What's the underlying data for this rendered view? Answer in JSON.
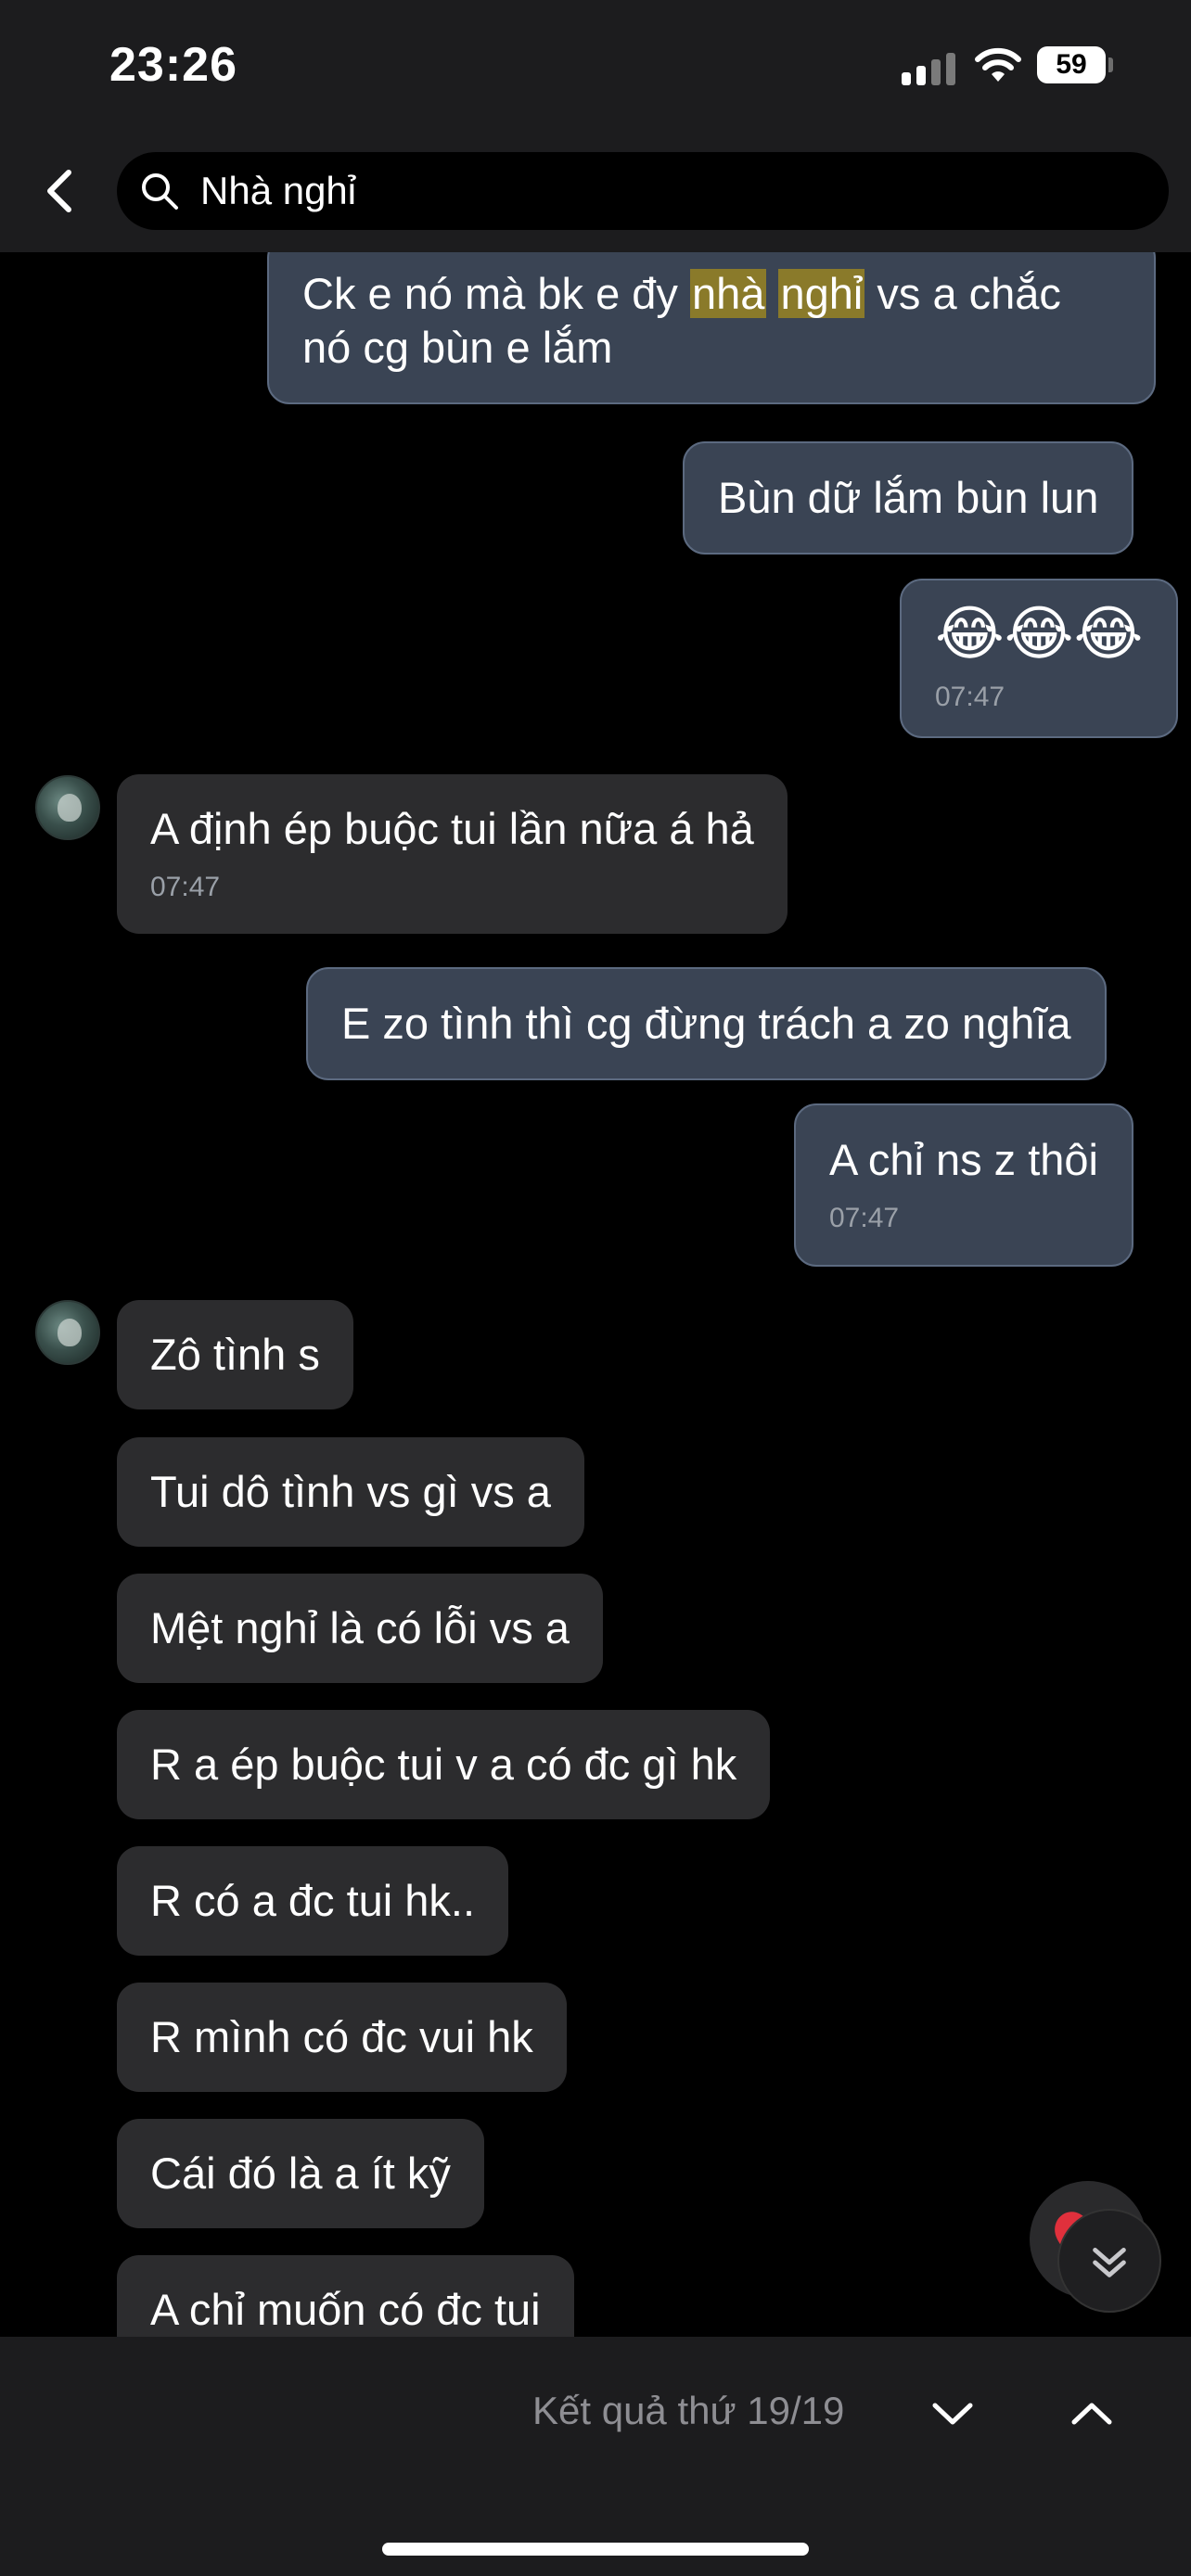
{
  "status": {
    "time": "23:26",
    "battery": "59"
  },
  "search": {
    "query": "Nhà nghỉ"
  },
  "messages": {
    "m1_before": "Ck e nó mà bk e đy ",
    "m1_hl1": "nhà",
    "m1_hl2": "nghỉ",
    "m1_after": " vs a chắc",
    "m1_line2": "nó cg bùn e lắm",
    "m2": "Bùn dữ lắm bùn lun",
    "m3": "😂😂😂",
    "m3_time": "07:47",
    "m4": "A định ép buộc tui lần nữa á hả",
    "m4_time": "07:47",
    "m5": "E zo tình thì cg đừng trách a zo nghĩa",
    "m6": "A chỉ ns z thôi",
    "m6_time": "07:47",
    "m7": "Zô tình s",
    "m8": "Tui dô tình vs gì vs a",
    "m9": "Mệt nghỉ là có lỗi vs a",
    "m10": "R a ép buộc tui v a có đc gì hk",
    "m11": "R có a đc tui hk..",
    "m12": "R mình có đc vui hk",
    "m13": "Cái đó là a ít kỹ",
    "m14": "A chỉ muốn có đc tui"
  },
  "footer": {
    "result": "Kết quả thứ 19/19"
  },
  "colors": {
    "sent_bubble": "#3a4454",
    "received_bubble": "#2c2c2e",
    "highlight": "#8a7a2a",
    "bar": "#1c1c1e"
  },
  "icons": [
    "back-chevron-icon",
    "search-icon",
    "signal-icon",
    "wifi-icon",
    "battery-icon",
    "heart-reaction-icon",
    "double-chevron-down-icon",
    "chevron-down-icon",
    "chevron-up-icon"
  ]
}
